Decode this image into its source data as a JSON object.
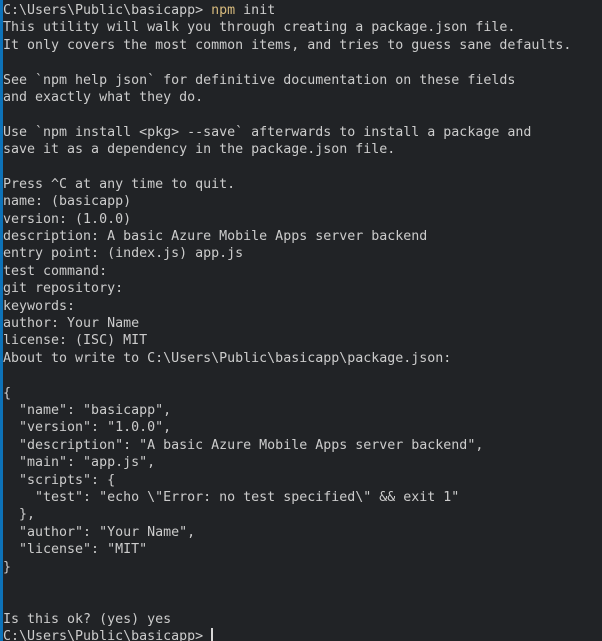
{
  "terminal": {
    "app": "windows-command-prompt",
    "colors": {
      "background": "#212326",
      "foreground": "#cccccc",
      "accent_yellow": "#d7ba7d",
      "focus_border": "#0d72b8",
      "cursor": "#d8d8d8"
    },
    "cwd": "C:\\Users\\Public\\basicapp",
    "prompt": "C:\\Users\\Public\\basicapp>",
    "command": {
      "program": "npm",
      "args": "init"
    },
    "cursor": {
      "shape": "bar",
      "visible": true
    },
    "lines": [
      {
        "id": "line-prompt-command",
        "kind": "prompt",
        "segments": [
          {
            "text": "C:\\Users\\Public\\basicapp> ",
            "color": "default"
          },
          {
            "text": "npm",
            "color": "yellow"
          },
          {
            "text": " init",
            "color": "default"
          }
        ]
      },
      {
        "id": "line-1",
        "kind": "output",
        "text": "This utility will walk you through creating a package.json file."
      },
      {
        "id": "line-2",
        "kind": "output",
        "text": "It only covers the most common items, and tries to guess sane defaults."
      },
      {
        "id": "line-3",
        "kind": "blank",
        "text": ""
      },
      {
        "id": "line-4",
        "kind": "output",
        "text": "See `npm help json` for definitive documentation on these fields"
      },
      {
        "id": "line-5",
        "kind": "output",
        "text": "and exactly what they do."
      },
      {
        "id": "line-6",
        "kind": "blank",
        "text": ""
      },
      {
        "id": "line-7",
        "kind": "output",
        "text": "Use `npm install <pkg> --save` afterwards to install a package and"
      },
      {
        "id": "line-8",
        "kind": "output",
        "text": "save it as a dependency in the package.json file."
      },
      {
        "id": "line-9",
        "kind": "blank",
        "text": ""
      },
      {
        "id": "line-10",
        "kind": "output",
        "text": "Press ^C at any time to quit."
      },
      {
        "id": "line-11",
        "kind": "prompt-answer",
        "text": "name: (basicapp)"
      },
      {
        "id": "line-12",
        "kind": "prompt-answer",
        "text": "version: (1.0.0)"
      },
      {
        "id": "line-13",
        "kind": "prompt-answer",
        "text": "description: A basic Azure Mobile Apps server backend"
      },
      {
        "id": "line-14",
        "kind": "prompt-answer",
        "text": "entry point: (index.js) app.js"
      },
      {
        "id": "line-15",
        "kind": "prompt-answer",
        "text": "test command:"
      },
      {
        "id": "line-16",
        "kind": "prompt-answer",
        "text": "git repository:"
      },
      {
        "id": "line-17",
        "kind": "prompt-answer",
        "text": "keywords:"
      },
      {
        "id": "line-18",
        "kind": "prompt-answer",
        "text": "author: Your Name"
      },
      {
        "id": "line-19",
        "kind": "prompt-answer",
        "text": "license: (ISC) MIT"
      },
      {
        "id": "line-20",
        "kind": "output",
        "text": "About to write to C:\\Users\\Public\\basicapp\\package.json:"
      },
      {
        "id": "line-21",
        "kind": "blank",
        "text": ""
      },
      {
        "id": "line-22",
        "kind": "json",
        "text": "{"
      },
      {
        "id": "line-23",
        "kind": "json",
        "text": "  \"name\": \"basicapp\","
      },
      {
        "id": "line-24",
        "kind": "json",
        "text": "  \"version\": \"1.0.0\","
      },
      {
        "id": "line-25",
        "kind": "json",
        "text": "  \"description\": \"A basic Azure Mobile Apps server backend\","
      },
      {
        "id": "line-26",
        "kind": "json",
        "text": "  \"main\": \"app.js\","
      },
      {
        "id": "line-27",
        "kind": "json",
        "text": "  \"scripts\": {"
      },
      {
        "id": "line-28",
        "kind": "json",
        "text": "    \"test\": \"echo \\\"Error: no test specified\\\" && exit 1\""
      },
      {
        "id": "line-29",
        "kind": "json",
        "text": "  },"
      },
      {
        "id": "line-30",
        "kind": "json",
        "text": "  \"author\": \"Your Name\","
      },
      {
        "id": "line-31",
        "kind": "json",
        "text": "  \"license\": \"MIT\""
      },
      {
        "id": "line-32",
        "kind": "json",
        "text": "}"
      },
      {
        "id": "line-33",
        "kind": "blank",
        "text": ""
      },
      {
        "id": "line-34",
        "kind": "blank",
        "text": ""
      },
      {
        "id": "line-35",
        "kind": "prompt-answer",
        "text": "Is this ok? (yes) yes"
      },
      {
        "id": "line-36",
        "kind": "prompt-cursor",
        "segments": [
          {
            "text": "C:\\Users\\Public\\basicapp> ",
            "color": "default"
          }
        ]
      }
    ]
  },
  "package_json": {
    "name": "basicapp",
    "version": "1.0.0",
    "description": "A basic Azure Mobile Apps server backend",
    "main": "app.js",
    "scripts_test": "echo \\\"Error: no test specified\\\" && exit 1",
    "author": "Your Name",
    "license": "MIT"
  },
  "npm_answers": {
    "name": "basicapp",
    "version": "1.0.0",
    "description": "A basic Azure Mobile Apps server backend",
    "entry_point": "app.js",
    "entry_point_default": "index.js",
    "test_command": "",
    "git_repository": "",
    "keywords": "",
    "author": "Your Name",
    "license": "MIT",
    "license_default": "ISC",
    "confirm": "yes"
  }
}
